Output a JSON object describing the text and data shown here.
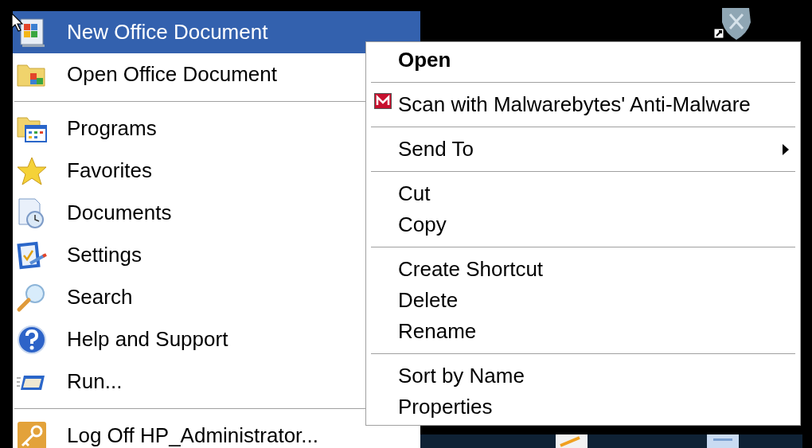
{
  "start_menu": {
    "items": [
      {
        "kind": "item",
        "label": "New Office Document",
        "selected": true
      },
      {
        "kind": "item",
        "label": "Open Office Document",
        "selected": false
      },
      {
        "kind": "separator"
      },
      {
        "kind": "item",
        "label": "Programs",
        "selected": false
      },
      {
        "kind": "item",
        "label": "Favorites",
        "selected": false
      },
      {
        "kind": "item",
        "label": "Documents",
        "selected": false
      },
      {
        "kind": "item",
        "label": "Settings",
        "selected": false
      },
      {
        "kind": "item",
        "label": "Search",
        "selected": false
      },
      {
        "kind": "item",
        "label": "Help and Support",
        "selected": false
      },
      {
        "kind": "item",
        "label": "Run...",
        "selected": false
      },
      {
        "kind": "separator"
      },
      {
        "kind": "item",
        "label": "Log Off HP_Administrator...",
        "selected": false
      }
    ]
  },
  "context_menu": {
    "items": [
      {
        "kind": "item",
        "label": "Open",
        "default": true,
        "selected": false
      },
      {
        "kind": "separator"
      },
      {
        "kind": "item",
        "label": "Scan with Malwarebytes' Anti-Malware",
        "has_icon": true,
        "selected": false
      },
      {
        "kind": "separator"
      },
      {
        "kind": "item",
        "label": "Send To",
        "submenu": true,
        "selected": false
      },
      {
        "kind": "separator"
      },
      {
        "kind": "item",
        "label": "Cut",
        "selected": false
      },
      {
        "kind": "item",
        "label": "Copy",
        "selected": false
      },
      {
        "kind": "separator"
      },
      {
        "kind": "item",
        "label": "Create Shortcut",
        "selected": false
      },
      {
        "kind": "item",
        "label": "Delete",
        "selected": false
      },
      {
        "kind": "item",
        "label": "Rename",
        "selected": false
      },
      {
        "kind": "separator"
      },
      {
        "kind": "item",
        "label": "Sort by Name",
        "selected": false
      },
      {
        "kind": "item",
        "label": "Properties",
        "selected": false
      }
    ]
  }
}
